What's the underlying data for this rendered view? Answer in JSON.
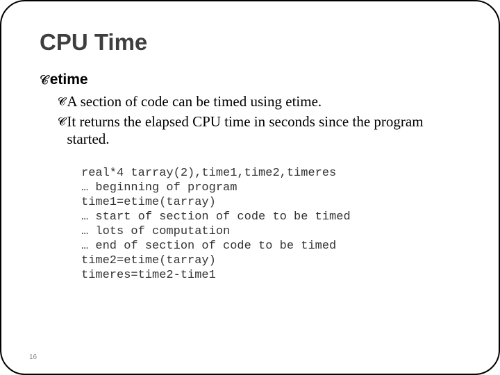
{
  "slide": {
    "title": "CPU Time",
    "level1": {
      "text": "etime"
    },
    "level2": {
      "a": "A section of code can be timed using etime.",
      "b": "It returns the elapsed CPU time in seconds since the program started."
    },
    "code": {
      "l1": "real*4 tarray(2),time1,time2,timeres",
      "l2": "… beginning of program",
      "l3": "time1=etime(tarray)",
      "l4": "… start of section of code to be timed",
      "l5": "… lots of computation",
      "l6": "… end of section of code to be timed",
      "l7": "time2=etime(tarray)",
      "l8": "timeres=time2-time1"
    },
    "page_number": "16"
  }
}
